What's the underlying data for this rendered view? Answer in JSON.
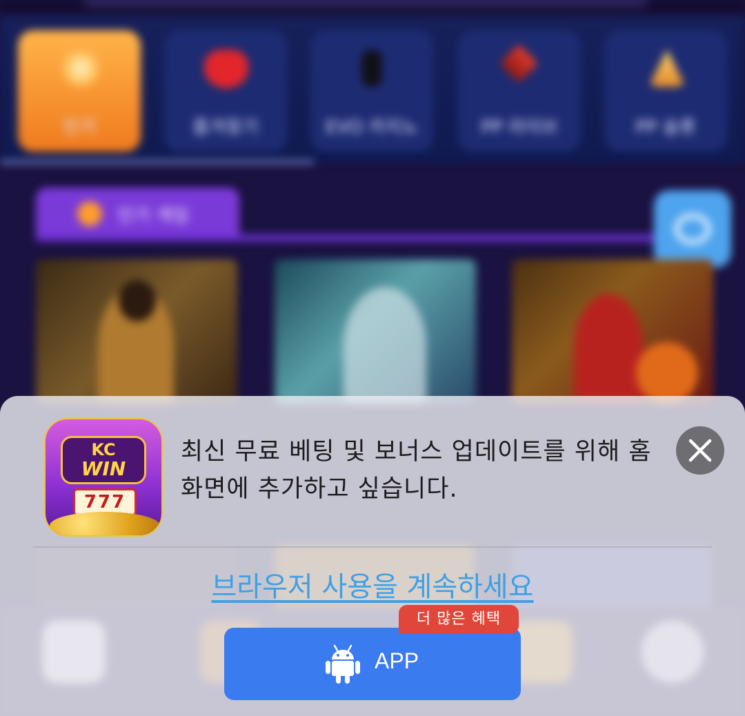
{
  "background": {
    "categories": [
      {
        "label": "인기",
        "active": true,
        "icon": "flame-icon"
      },
      {
        "label": "즐겨찾기",
        "active": false,
        "icon": "heart-icon"
      },
      {
        "label": "EVO 카지노",
        "active": false,
        "icon": "chip-icon"
      },
      {
        "label": "PP 라이브",
        "active": false,
        "icon": "cards-icon"
      },
      {
        "label": "PP 슬롯",
        "active": false,
        "icon": "slot-icon"
      }
    ],
    "section_title": "인기 게임"
  },
  "prompt": {
    "app_icon": {
      "brand_top": "KC",
      "brand_bottom": "WIN",
      "slot_digits": "777"
    },
    "message": "최신 무료 베팅 및 보너스 업데이트를 위해 홈 화면에 추가하고 싶습니다.",
    "continue_link": "브라우저 사용을 계속하세요",
    "app_button_label": "APP",
    "promo_badge": "더 많은 혜택"
  },
  "colors": {
    "accent": "#3b7bf0",
    "link": "#3fa0e6",
    "badge": "#e0473a"
  }
}
